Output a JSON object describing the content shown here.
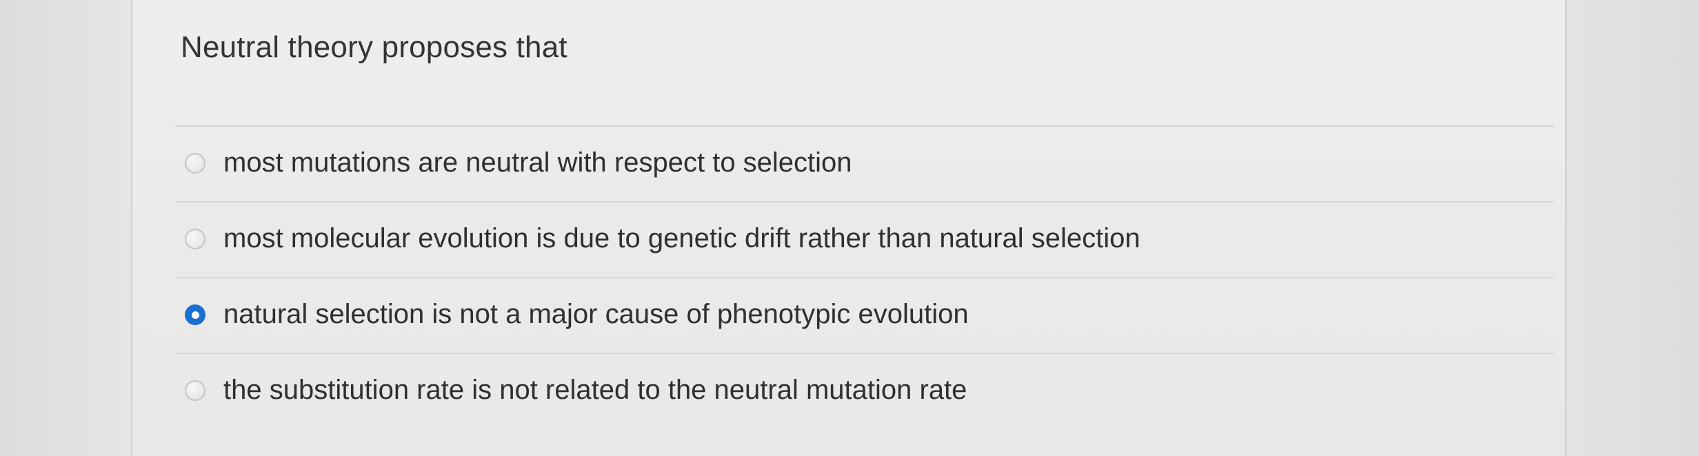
{
  "question": {
    "text": "Neutral theory proposes that"
  },
  "answers": [
    {
      "label": "most mutations are neutral with respect to selection",
      "selected": false
    },
    {
      "label": "most molecular evolution is due to genetic drift rather than natural selection",
      "selected": false
    },
    {
      "label": "natural selection is not a major cause of phenotypic evolution",
      "selected": true
    },
    {
      "label": "the substitution rate is not related to the neutral mutation rate",
      "selected": false
    }
  ],
  "colors": {
    "selected_radio": "#1a6fd1",
    "text": "#333333"
  }
}
